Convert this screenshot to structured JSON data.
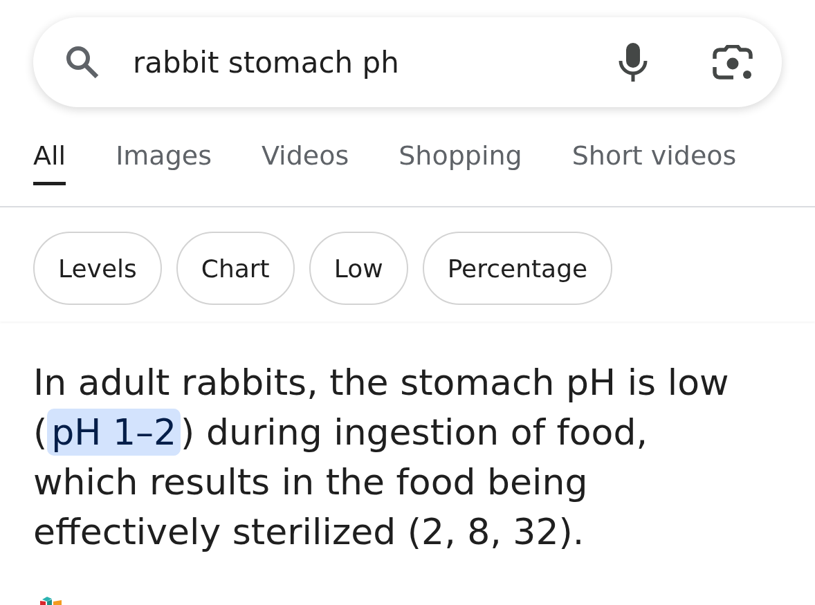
{
  "search": {
    "query": "rabbit stomach ph"
  },
  "tabs": [
    {
      "label": "All",
      "selected": true
    },
    {
      "label": "Images",
      "selected": false
    },
    {
      "label": "Videos",
      "selected": false
    },
    {
      "label": "Shopping",
      "selected": false
    },
    {
      "label": "Short videos",
      "selected": false
    }
  ],
  "chips": [
    "Levels",
    "Chart",
    "Low",
    "Percentage"
  ],
  "answer": {
    "segments": [
      {
        "text": "In adult rabbits, the stomach pH is low (",
        "highlighted": false
      },
      {
        "text": "pH 1–2",
        "highlighted": true
      },
      {
        "text": ") during ingestion of food, which results in the food being effectively sterilized (2, 8, 32).",
        "highlighted": false
      }
    ]
  }
}
